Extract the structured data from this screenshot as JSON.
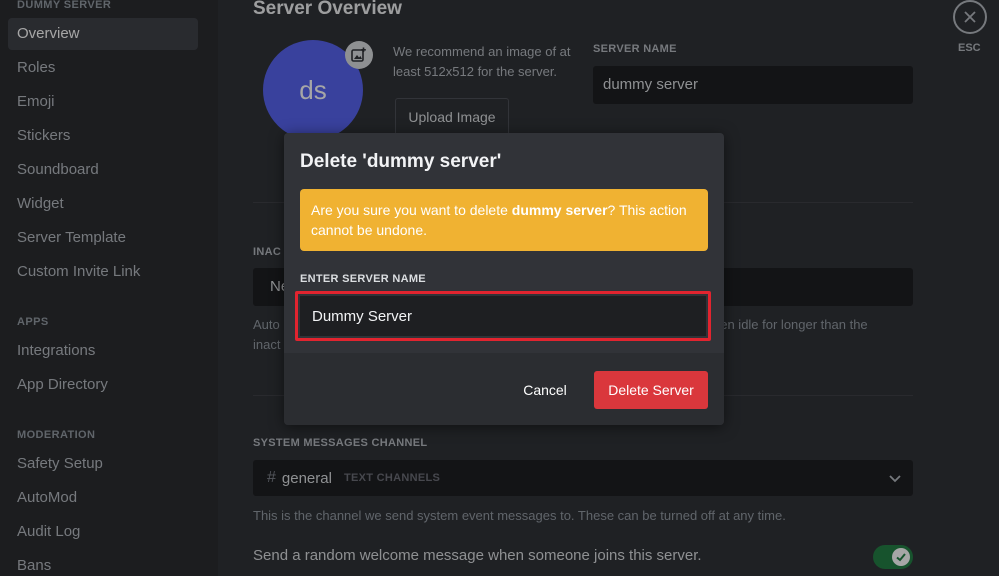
{
  "sidebar": {
    "header": "DUMMY SERVER",
    "sections": [
      {
        "heading": "",
        "items": [
          "Overview",
          "Roles",
          "Emoji",
          "Stickers",
          "Soundboard",
          "Widget",
          "Server Template",
          "Custom Invite Link"
        ]
      },
      {
        "heading": "APPS",
        "items": [
          "Integrations",
          "App Directory"
        ]
      },
      {
        "heading": "MODERATION",
        "items": [
          "Safety Setup",
          "AutoMod",
          "Audit Log",
          "Bans"
        ]
      }
    ],
    "active_item": "Overview"
  },
  "main": {
    "title": "Server Overview",
    "avatar_initials": "ds",
    "recommend_text": "We recommend an image of at least 512x512 for the server.",
    "upload_label": "Upload Image",
    "server_name_label": "SERVER NAME",
    "server_name_value": "dummy server",
    "inactive_label": "INAC",
    "inactive_value": "Ne",
    "inactive_hint_left": "Auto",
    "inactive_hint_left2": "inact",
    "inactive_hint_right": "een idle for longer than the",
    "system_label": "SYSTEM MESSAGES CHANNEL",
    "system_channel": "general",
    "system_category": "TEXT CHANNELS",
    "system_hint": "This is the channel we send system event messages to. These can be turned off at any time.",
    "welcome_text": "Send a random welcome message when someone joins this server.",
    "welcome_enabled": true,
    "esc_label": "ESC"
  },
  "modal": {
    "title": "Delete 'dummy server'",
    "warning_prefix": "Are you sure you want to delete ",
    "warning_bold": "dummy server",
    "warning_suffix": "? This action cannot be undone.",
    "input_label": "ENTER SERVER NAME",
    "input_value": "Dummy Server",
    "cancel_label": "Cancel",
    "delete_label": "Delete Server"
  },
  "colors": {
    "accent": "#5865f2",
    "danger": "#da373c",
    "warning": "#f0b232",
    "highlight": "#e1242f",
    "toggle_on": "#248046"
  }
}
